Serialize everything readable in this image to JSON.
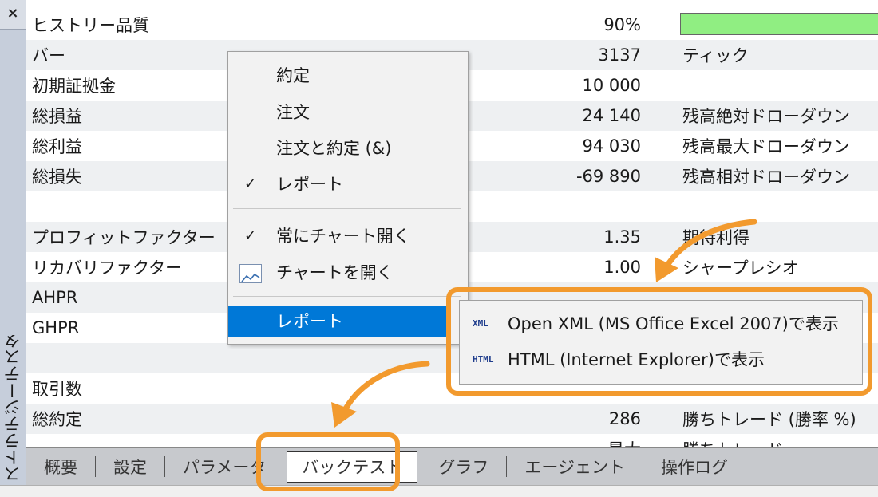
{
  "sidebar": {
    "close_glyph": "×",
    "title": "ストラテジーテスター"
  },
  "report": {
    "rows": [
      {
        "label": "ヒストリー品質",
        "value": "90%",
        "right": ""
      },
      {
        "label": "バー",
        "value": "3137",
        "right": "ティック"
      },
      {
        "label": "初期証拠金",
        "value": "10 000",
        "right": ""
      },
      {
        "label": "総損益",
        "value": "24 140",
        "right": "残高絶対ドローダウン"
      },
      {
        "label": "総利益",
        "value": "94 030",
        "right": "残高最大ドローダウン"
      },
      {
        "label": "総損失",
        "value": "-69 890",
        "right": "残高相対ドローダウン"
      },
      {
        "label": "",
        "value": "",
        "right": ""
      },
      {
        "label": "プロフィットファクター",
        "value": "1.35",
        "right": "期待利得"
      },
      {
        "label": "リカバリファクター",
        "value": "1.00",
        "right": "シャープレシオ"
      },
      {
        "label": "AHPR",
        "value": "",
        "right": ""
      },
      {
        "label": "GHPR",
        "value": "",
        "right": ""
      },
      {
        "label": "",
        "value": "",
        "right": ""
      },
      {
        "label": "取引数",
        "value": "",
        "right": ""
      },
      {
        "label": "総約定",
        "value": "286",
        "right": "勝ちトレード (勝率 %)"
      },
      {
        "label": "",
        "value": "最大",
        "right": "勝ちトレード"
      }
    ],
    "quality_percent": 90,
    "quality_color": "#90ee82"
  },
  "context_menu": {
    "item1": "約定",
    "item2": "注文",
    "item3": "注文と約定 (&)",
    "item4": "レポート",
    "item5": "常にチャート開く",
    "item6": "チャートを開く",
    "item7": "レポート",
    "check_glyph": "✓"
  },
  "submenu": {
    "xml_tag": "XML",
    "xml_label": "Open XML (MS Office Excel 2007)で表示",
    "html_tag": "HTML",
    "html_label": "HTML (Internet Explorer)で表示"
  },
  "tabs": [
    "概要",
    "設定",
    "パラメータ",
    "バックテスト",
    "グラフ",
    "エージェント",
    "操作ログ"
  ],
  "colors": {
    "highlight": "#f29a2e",
    "selection": "#0078d7"
  }
}
